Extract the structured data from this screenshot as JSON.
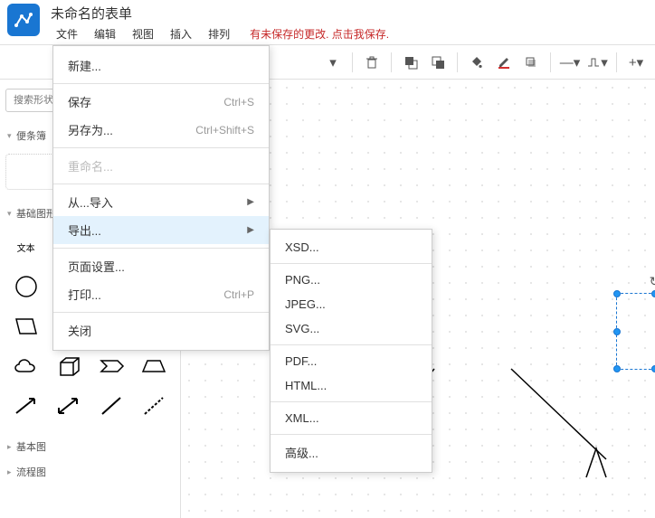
{
  "header": {
    "title": "未命名的表单",
    "menus": {
      "file": "文件",
      "edit": "编辑",
      "view": "视图",
      "insert": "插入",
      "arrange": "排列"
    },
    "unsaved_msg": "有未保存的更改. 点击我保存."
  },
  "sidebar": {
    "search_placeholder": "搜索形状",
    "section_notepad": "便条簿",
    "section_basic": "基础图形",
    "label_text": "文本",
    "section_basic2": "基本图",
    "section_flow": "流程图"
  },
  "file_menu": {
    "new": "新建...",
    "save": "保存",
    "save_sc": "Ctrl+S",
    "saveas": "另存为...",
    "saveas_sc": "Ctrl+Shift+S",
    "rename": "重命名...",
    "import": "从...导入",
    "export": "导出...",
    "pagesetup": "页面设置...",
    "print": "打印...",
    "print_sc": "Ctrl+P",
    "close": "关闭"
  },
  "export_menu": {
    "xsd": "XSD...",
    "png": "PNG...",
    "jpeg": "JPEG...",
    "svg": "SVG...",
    "pdf": "PDF...",
    "html": "HTML...",
    "xml": "XML...",
    "adv": "高级..."
  }
}
